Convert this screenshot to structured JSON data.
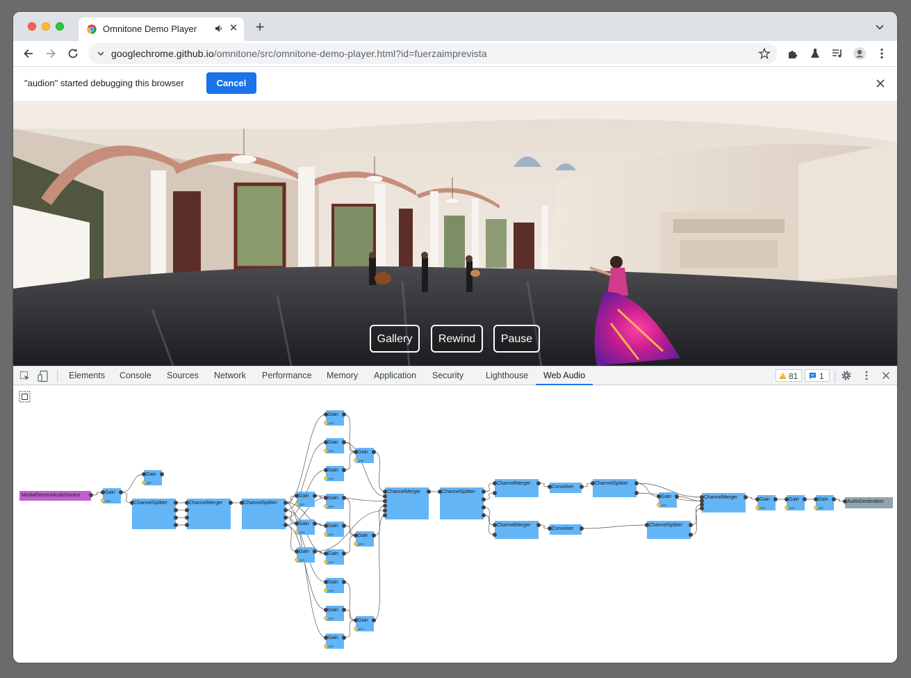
{
  "browser": {
    "tab_title": "Omnitone Demo Player",
    "url_host": "googlechrome.github.io",
    "url_path": "/omnitone/src/omnitone-demo-player.html?id=fuerzaimprevista",
    "new_tab_label": "+"
  },
  "infobar": {
    "message": "\"audion\" started debugging this browser",
    "cancel_label": "Cancel"
  },
  "player": {
    "buttons": [
      "Gallery",
      "Rewind",
      "Pause"
    ]
  },
  "devtools": {
    "tabs": [
      "Elements",
      "Console",
      "Sources",
      "Network",
      "Performance",
      "Memory",
      "Application",
      "Security",
      "Lighthouse",
      "Web Audio"
    ],
    "active_tab": "Web Audio",
    "warning_count": "81",
    "message_count": "1"
  },
  "audio_graph": {
    "source_node": "MediaElementAudioSource",
    "destination_node": "AudioDestination",
    "gain_label": "Gain",
    "gain_param": "gain",
    "splitter_label": "ChannelSplitter",
    "merger_label": "ChannelMerger",
    "convolver_label": "Convolver"
  },
  "colors": {
    "node_blue": "#64b5f6",
    "source_purple": "#c05fcf",
    "destination_gray": "#90a4ae",
    "chrome_blue": "#1a73e8"
  }
}
